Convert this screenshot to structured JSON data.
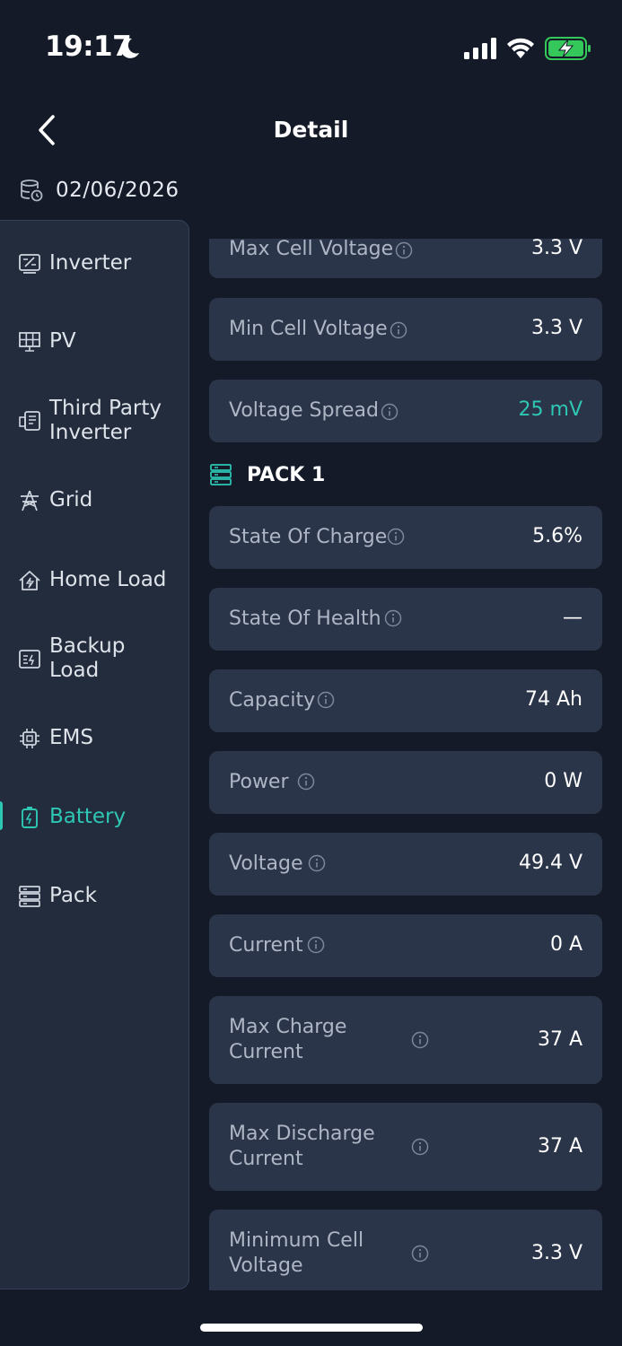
{
  "status_bar": {
    "time": "19:17"
  },
  "header": {
    "title": "Detail",
    "date": "02/06/2026"
  },
  "sidebar": {
    "items": [
      {
        "label": "Inverter",
        "icon": "inverter-icon"
      },
      {
        "label": "PV",
        "icon": "solar-panel-icon"
      },
      {
        "label": "Third Party Inverter",
        "line1": "Third Party",
        "line2": "Inverter",
        "icon": "third-party-inverter-icon"
      },
      {
        "label": "Grid",
        "icon": "grid-tower-icon"
      },
      {
        "label": "Home Load",
        "icon": "home-load-icon"
      },
      {
        "label": "Backup Load",
        "line1": "Backup",
        "line2": "Load",
        "icon": "backup-load-icon"
      },
      {
        "label": "EMS",
        "icon": "chip-icon"
      },
      {
        "label": "Battery",
        "icon": "battery-icon",
        "active": true
      },
      {
        "label": "Pack",
        "icon": "pack-icon"
      }
    ],
    "accent_color": "#2ec7b4"
  },
  "metrics": [
    {
      "label": "Max Cell Voltage",
      "value": "3.3 V"
    },
    {
      "label": "Min Cell Voltage",
      "value": "3.3 V"
    },
    {
      "label": "Voltage Spread",
      "value": "25 mV",
      "color": "#2ec7b4"
    }
  ],
  "pack": {
    "title": "PACK 1",
    "icon": "pack-icon",
    "metrics": [
      {
        "label": "State Of Charge",
        "value": "5.6%"
      },
      {
        "label": "State Of Health",
        "value": "—"
      },
      {
        "label": "Capacity",
        "value": "74 Ah"
      },
      {
        "label": "Power",
        "value": "0 W"
      },
      {
        "label": "Voltage",
        "value": "49.4 V"
      },
      {
        "label": "Current",
        "value": "0 A"
      },
      {
        "label": "Max Charge Current",
        "line1": "Max Charge",
        "line2": "Current",
        "value": "37 A"
      },
      {
        "label": "Max Discharge Current",
        "line1": "Max Discharge",
        "line2": "Current",
        "value": "37 A"
      },
      {
        "label": "Minimum Cell Voltage",
        "line1": "Minimum Cell",
        "line2": "Voltage",
        "value": "3.3 V"
      }
    ]
  }
}
